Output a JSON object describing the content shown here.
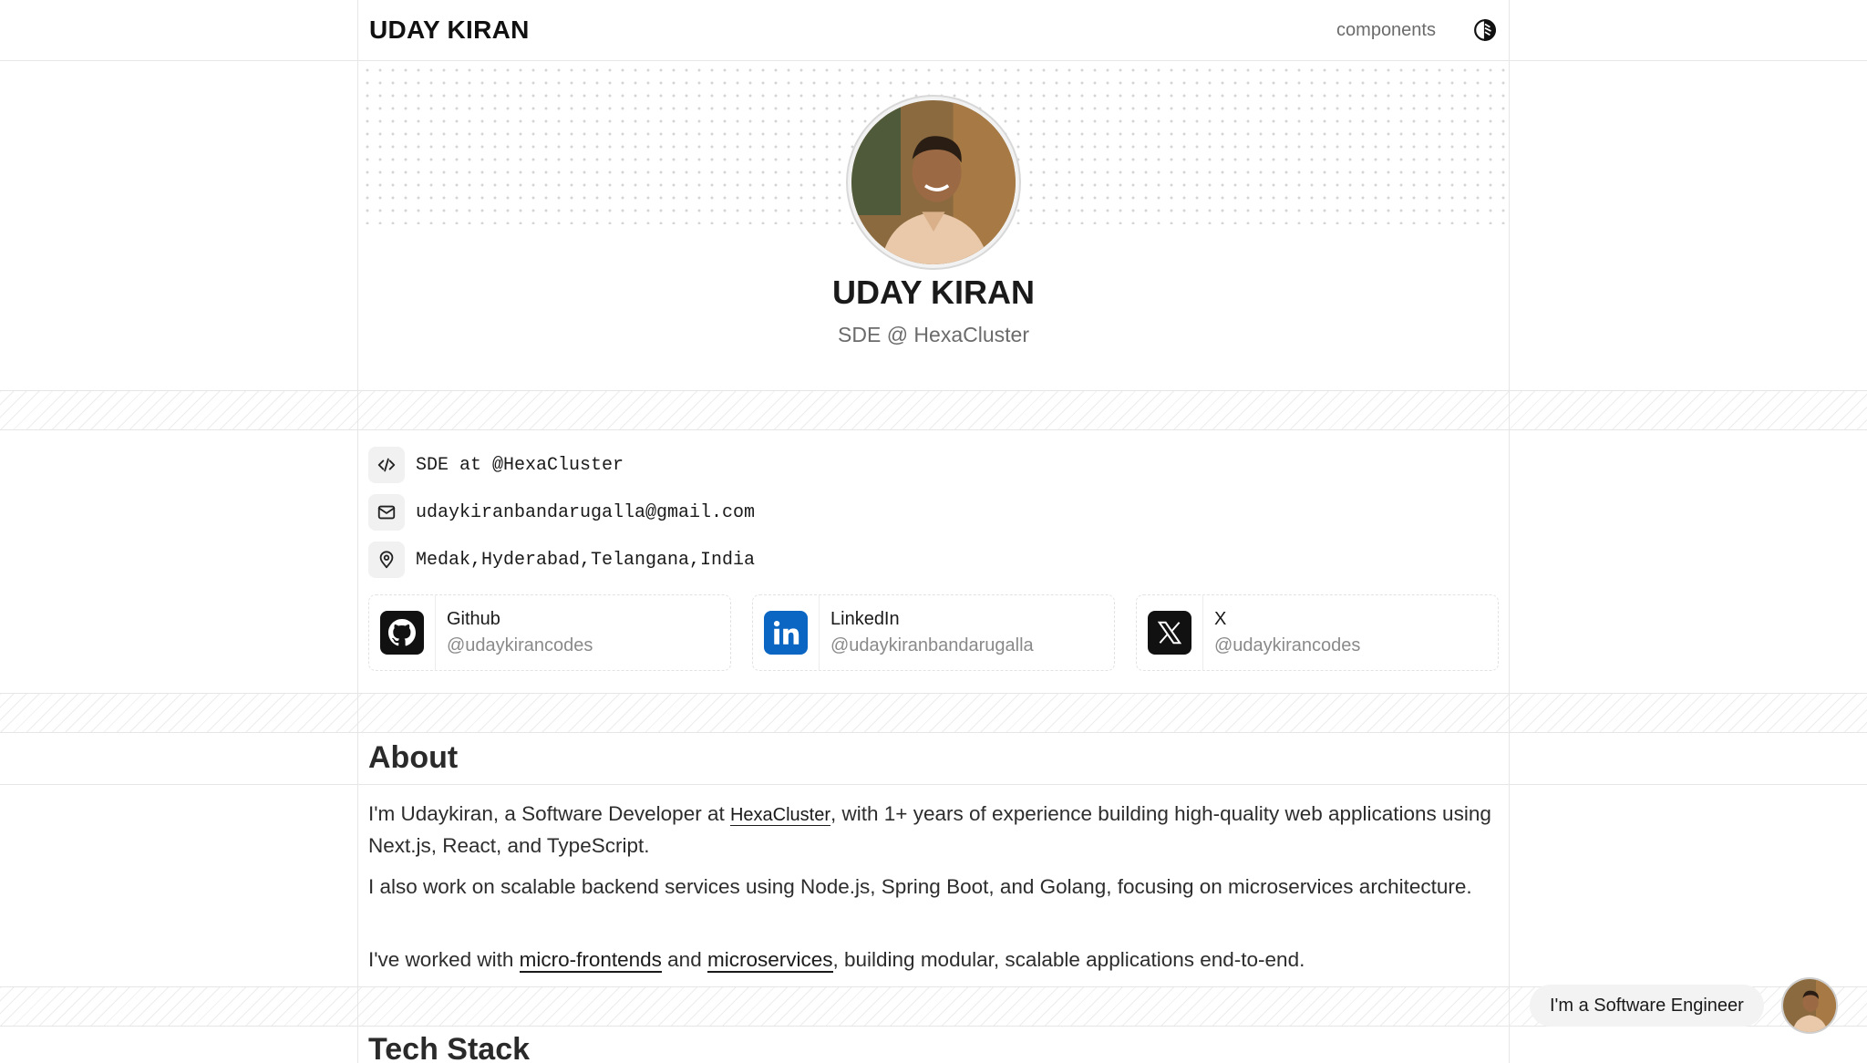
{
  "header": {
    "brand": "UDAY KIRAN",
    "nav_link": "components",
    "theme_icon": "theme-toggle-icon"
  },
  "hero": {
    "name": "UDAY KIRAN",
    "role": "SDE @ HexaCluster"
  },
  "info": [
    {
      "icon": "code-icon",
      "text": "SDE at @HexaCluster"
    },
    {
      "icon": "mail-icon",
      "text": "udaykiranbandarugalla@gmail.com"
    },
    {
      "icon": "map-pin-icon",
      "text": "Medak,Hyderabad,Telangana,India"
    }
  ],
  "socials": [
    {
      "name": "Github",
      "handle": "@udaykirancodes",
      "icon": "github-icon"
    },
    {
      "name": "LinkedIn",
      "handle": "@udaykiranbandarugalla",
      "icon": "linkedin-icon"
    },
    {
      "name": "X",
      "handle": "@udaykirancodes",
      "icon": "x-icon"
    }
  ],
  "about": {
    "title": "About",
    "p1_a": "I'm Udaykiran, a Software Developer at ",
    "p1_link": "HexaCluster",
    "p1_b": ", with 1+ years of experience building high-quality web applications using Next.js, React, and TypeScript.",
    "p2": "I also work on scalable backend services using Node.js, Spring Boot, and Golang, focusing on microservices architecture.",
    "p3_a": "I've worked with ",
    "p3_link1": "micro-frontends",
    "p3_mid": " and ",
    "p3_link2": "microservices",
    "p3_b": ", building modular, scalable applications end-to-end."
  },
  "tech": {
    "title": "Tech Stack"
  },
  "chip": {
    "text": "I'm a Software Engineer"
  },
  "colors": {
    "linkedin": "#0a66c2",
    "dark": "#111111",
    "muted": "#6b6b6b"
  }
}
